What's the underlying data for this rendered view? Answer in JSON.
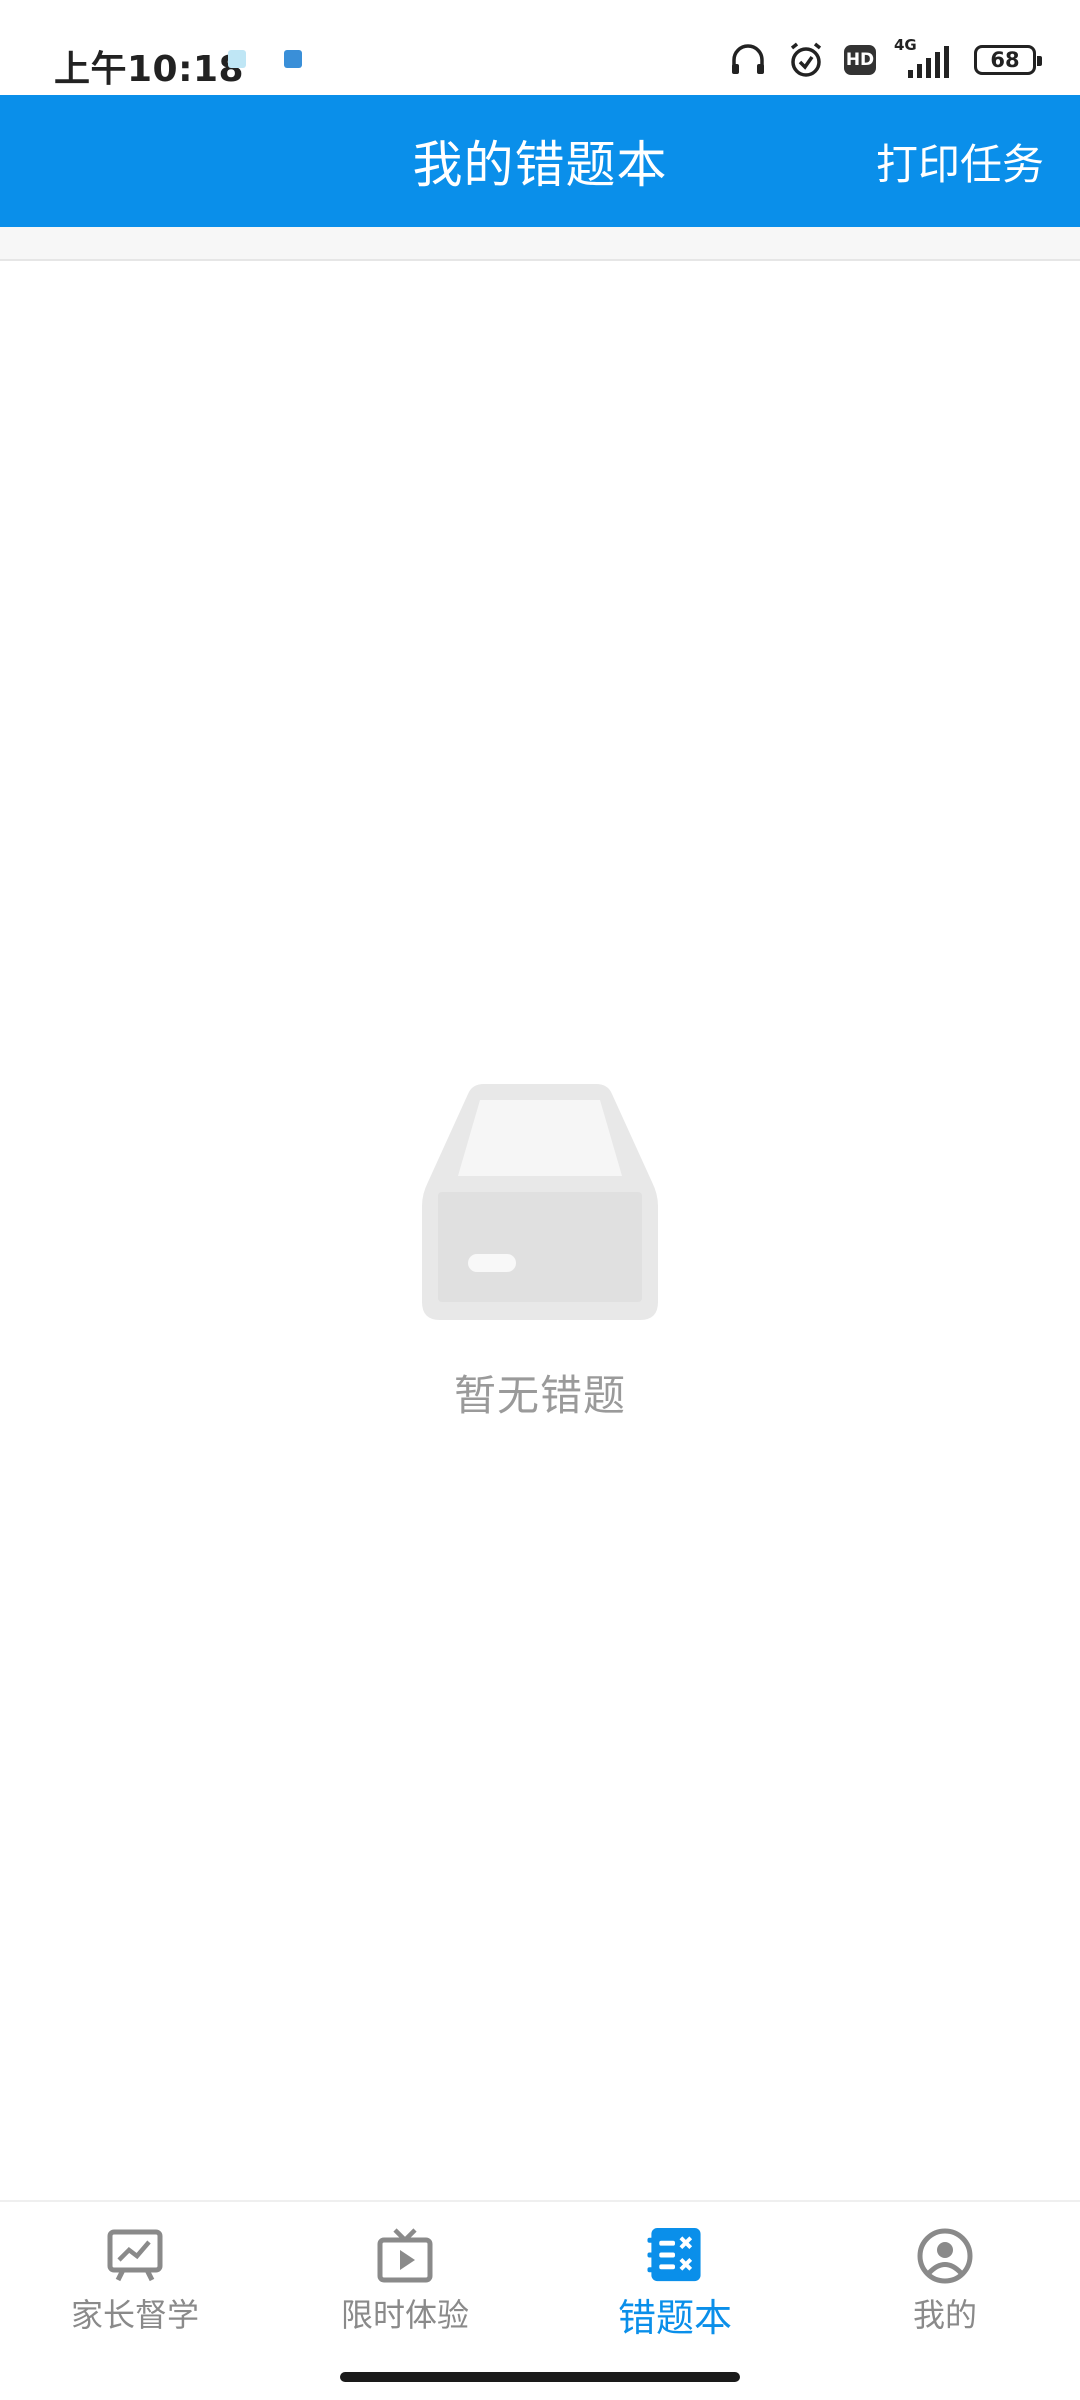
{
  "status_bar": {
    "time": "上午10:18",
    "network": "4G",
    "battery": "68",
    "hd": "HD"
  },
  "header": {
    "title": "我的错题本",
    "action": "打印任务"
  },
  "empty_state": {
    "message": "暂无错题"
  },
  "bottom_nav": {
    "items": [
      {
        "label": "家长督学",
        "icon": "chart-board-icon"
      },
      {
        "label": "限时体验",
        "icon": "tv-play-icon"
      },
      {
        "label": "错题本",
        "icon": "wrong-book-icon",
        "active": true
      },
      {
        "label": "我的",
        "icon": "user-circle-icon"
      }
    ]
  },
  "colors": {
    "primary": "#0a8fea",
    "inactive": "#8a8a8a",
    "empty_text": "#9a9a9a"
  }
}
